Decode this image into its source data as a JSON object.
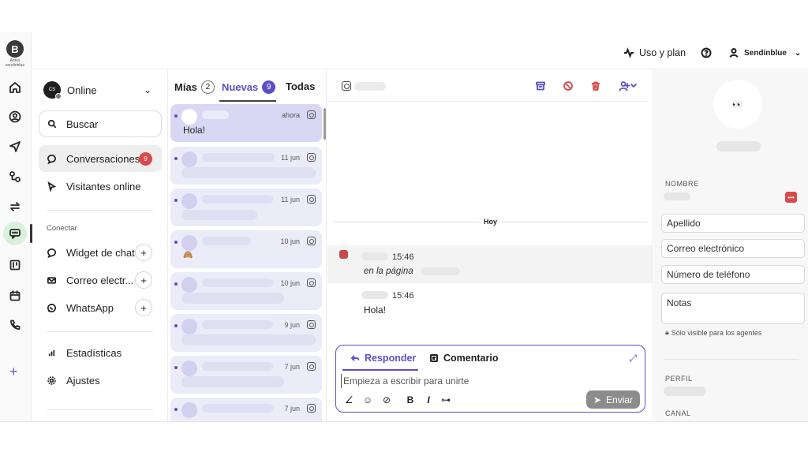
{
  "brand": {
    "logo_letter": "B",
    "logo_caption": "Antes sendinblue"
  },
  "topbar": {
    "plan_label": "Uso y plan",
    "account_label": "Sendinblue"
  },
  "status": {
    "avatar_initials": "CS",
    "label": "Online"
  },
  "nav": {
    "search_label": "Buscar",
    "conversations_label": "Conversaciones",
    "conversations_badge": "9",
    "visitors_label": "Visitantes online",
    "connect_section": "Conectar",
    "widget_label": "Widget de chat",
    "email_label": "Correo electr...",
    "whatsapp_label": "WhatsApp",
    "stats_label": "Estadísticas",
    "settings_label": "Ajustes"
  },
  "tabs": [
    {
      "label": "Mías",
      "count": "2"
    },
    {
      "label": "Nuevas",
      "count": "9"
    },
    {
      "label": "Todas"
    }
  ],
  "conversations": [
    {
      "time": "ahora",
      "preview": "Hola!"
    },
    {
      "time": "11 jun",
      "preview": ""
    },
    {
      "time": "11 jun",
      "preview": ""
    },
    {
      "time": "10 jun",
      "preview": "🙈"
    },
    {
      "time": "10 jun",
      "preview": ""
    },
    {
      "time": "9 jun",
      "preview": ""
    },
    {
      "time": "7 jun",
      "preview": ""
    },
    {
      "time": "7 jun",
      "preview": ""
    }
  ],
  "chat": {
    "day_divider": "Hoy",
    "message1": {
      "time": "15:46",
      "note": "en la página"
    },
    "message2": {
      "time": "15:46",
      "text": "Hola!"
    }
  },
  "composer": {
    "tab_reply": "Responder",
    "tab_comment": "Comentario",
    "placeholder": "Empieza a escribir para unirte",
    "send_label": "Enviar"
  },
  "contact": {
    "avatar_glyph": "👀",
    "name_label": "NOMBRE",
    "lastname_placeholder": "Apellido",
    "email_placeholder": "Correo electrónico",
    "phone_placeholder": "Número de teléfono",
    "notes_placeholder": "Notas",
    "private_note": "Sólo visible para los agentes",
    "profile_label": "PERFIL",
    "channel_label": "CANAL"
  },
  "colors": {
    "accent": "#5b4fc7",
    "alert": "#d94b4b",
    "active_rail": "#d9f0da"
  }
}
